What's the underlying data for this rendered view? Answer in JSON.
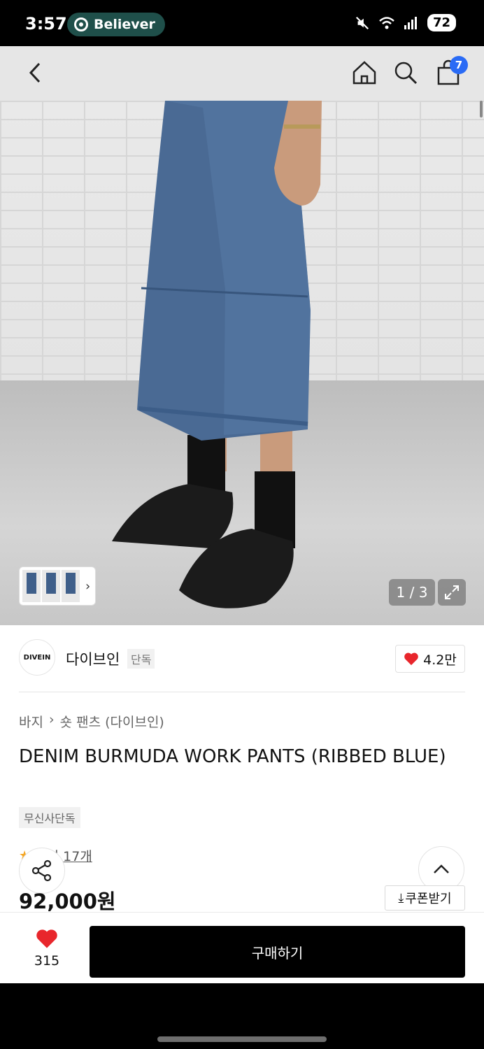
{
  "status_bar": {
    "time": "3:57",
    "media_pill": "Believer",
    "battery": "72"
  },
  "header": {
    "cart_badge": "7"
  },
  "gallery": {
    "counter": "1 / 3"
  },
  "brand": {
    "logo_text": "DIVEIN",
    "name": "다이브인",
    "tag": "단독",
    "likes": "4.2만"
  },
  "product": {
    "breadcrumb": [
      "바지",
      "숏 팬츠 (다이브인)"
    ],
    "title": "DENIM BURMUDA WORK PANTS (RIBBED BLUE)",
    "badge": "무신사단독",
    "review": "후기 17개",
    "price": "92,000원",
    "coupon": "쿠폰받기"
  },
  "bottom": {
    "wish_count": "315",
    "buy_label": "구매하기"
  },
  "colors": {
    "accent_heart": "#e8262c",
    "cart_badge": "#2a6bf5",
    "buy_button": "#000000"
  }
}
